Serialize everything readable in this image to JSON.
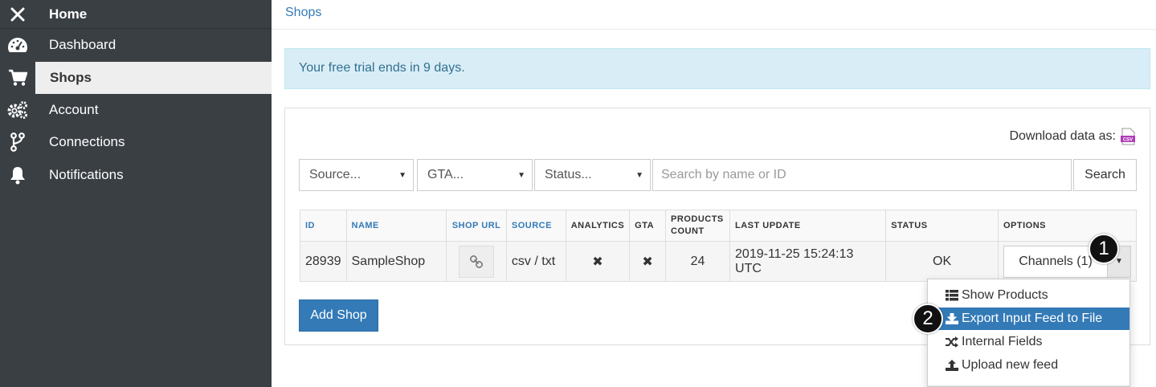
{
  "sidebar": {
    "items": [
      {
        "label": "Home",
        "icon": "close-icon"
      },
      {
        "label": "Dashboard",
        "icon": "dashboard-icon"
      },
      {
        "label": "Shops",
        "icon": "cart-icon"
      },
      {
        "label": "Account",
        "icon": "gears-icon"
      },
      {
        "label": "Connections",
        "icon": "branch-icon"
      },
      {
        "label": "Notifications",
        "icon": "bell-icon"
      }
    ]
  },
  "header": {
    "breadcrumb": "Shops"
  },
  "alert": {
    "text": "Your free trial ends in 9 days."
  },
  "panel": {
    "download_label": "Download data as:",
    "download_format": "CSV",
    "filters": {
      "source": "Source...",
      "gta": "GTA...",
      "status": "Status...",
      "search_placeholder": "Search by name or ID",
      "search_button": "Search"
    },
    "table": {
      "columns": [
        "ID",
        "NAME",
        "SHOP URL",
        "SOURCE",
        "ANALYTICS",
        "GTA",
        "PRODUCTS COUNT",
        "LAST UPDATE",
        "STATUS",
        "OPTIONS"
      ],
      "rows": [
        {
          "id": "28939",
          "name": "SampleShop",
          "source": "csv / txt",
          "analytics": "✖",
          "gta": "✖",
          "products_count": "24",
          "last_update": "2019-11-25 15:24:13 UTC",
          "status": "OK",
          "options": "Channels (1)"
        }
      ]
    },
    "add_shop": "Add Shop"
  },
  "dropdown": {
    "items": [
      {
        "label": "Show Products",
        "icon": "list-icon"
      },
      {
        "label": "Export Input Feed to File",
        "icon": "download-icon"
      },
      {
        "label": "Internal Fields",
        "icon": "shuffle-icon"
      },
      {
        "label": "Upload new feed",
        "icon": "upload-icon"
      }
    ]
  },
  "callouts": [
    "1",
    "2"
  ],
  "colors": {
    "sidebar": "#3a3f44",
    "accent": "#337ab7",
    "alert_bg": "#d9edf7",
    "status_ok": "#3c763d"
  }
}
